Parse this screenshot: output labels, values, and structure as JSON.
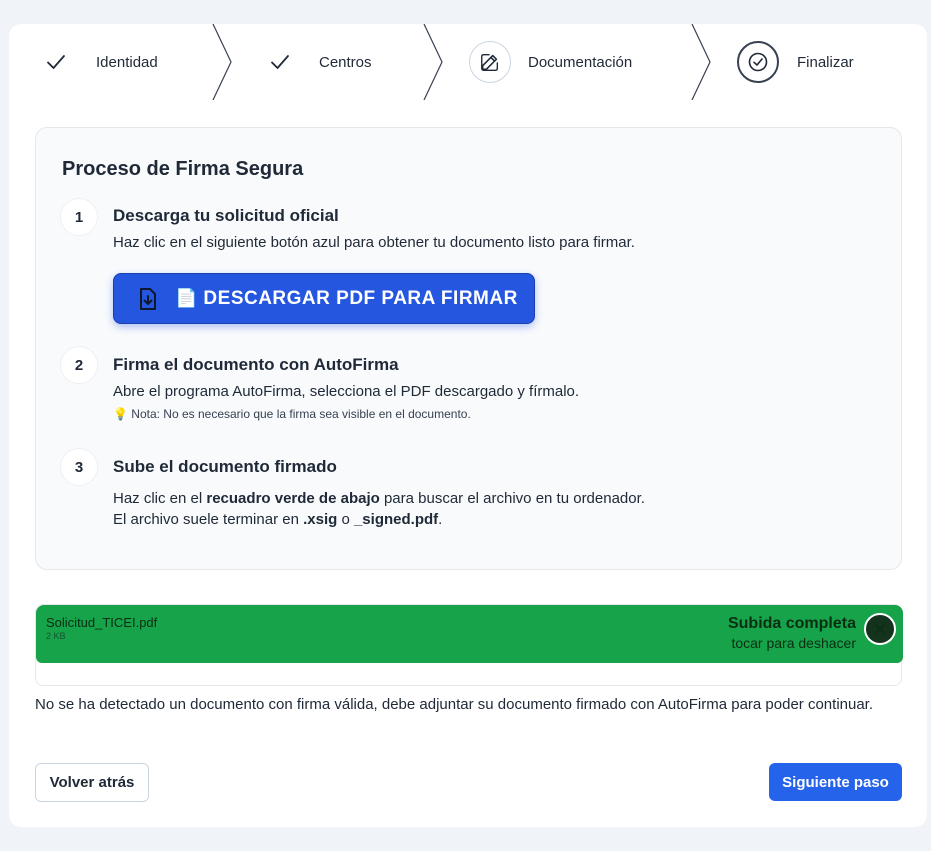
{
  "stepper": {
    "steps": [
      {
        "label": "Identidad",
        "state": "done",
        "icon": "check-icon"
      },
      {
        "label": "Centros",
        "state": "done",
        "icon": "check-icon"
      },
      {
        "label": "Documentación",
        "state": "current",
        "icon": "edit-icon"
      },
      {
        "label": "Finalizar",
        "state": "todo",
        "icon": "check-circle-icon"
      }
    ]
  },
  "panel": {
    "title": "Proceso de Firma Segura",
    "steps": [
      {
        "number": "1",
        "title": "Descarga tu solicitud oficial",
        "text": "Haz clic en el siguiente botón azul para obtener tu documento listo para firmar."
      },
      {
        "number": "2",
        "title": "Firma el documento con AutoFirma",
        "text": "Abre el programa AutoFirma, selecciona el PDF descargado y fírmalo.",
        "note": "💡 Nota: No es necesario que la firma sea visible en el documento."
      },
      {
        "number": "3",
        "title": "Sube el documento firmado",
        "line1_pre": "Haz clic en el ",
        "line1_bold": "recuadro verde de abajo",
        "line1_post": " para buscar el archivo en tu ordenador.",
        "line2_pre": "El archivo suele terminar en ",
        "line2_bold1": ".xsig",
        "line2_mid": " o ",
        "line2_bold2": "_signed.pdf",
        "line2_post": "."
      }
    ],
    "download_button": {
      "emoji": "📄",
      "label": "DESCARGAR PDF PARA FIRMAR",
      "icon": "file-download-icon"
    }
  },
  "upload": {
    "file_name": "Solicitud_TICEI.pdf",
    "file_size": "2 KB",
    "status": "Subida completa",
    "status_hint": "tocar para deshacer",
    "undo_icon": "close-icon"
  },
  "error_message": "No se ha detectado un documento con firma válida, debe adjuntar su documento firmado con AutoFirma para poder continuar.",
  "footer": {
    "back_label": "Volver atrás",
    "next_label": "Siguiente paso"
  },
  "colors": {
    "accent": "#2563eb",
    "download_button": "#2456e0",
    "success": "#16a34a",
    "background": "#f0f3f8"
  }
}
